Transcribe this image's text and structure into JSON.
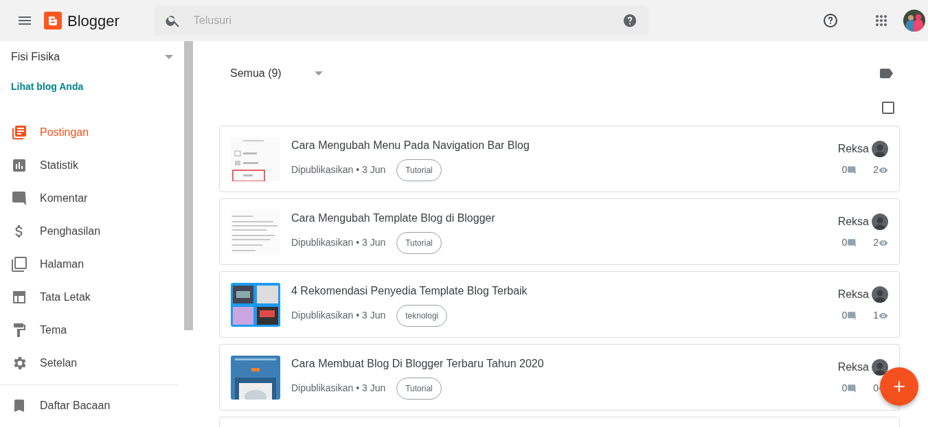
{
  "header": {
    "app_name": "Blogger",
    "search": {
      "placeholder": "Telusuri"
    }
  },
  "sidebar": {
    "blog_name": "Fisi Fisika",
    "view_blog_link": "Lihat blog Anda",
    "items": [
      {
        "label": "Postingan",
        "selected": true
      },
      {
        "label": "Statistik",
        "selected": false
      },
      {
        "label": "Komentar",
        "selected": false
      },
      {
        "label": "Penghasilan",
        "selected": false
      },
      {
        "label": "Halaman",
        "selected": false
      },
      {
        "label": "Tata Letak",
        "selected": false
      },
      {
        "label": "Tema",
        "selected": false
      },
      {
        "label": "Setelan",
        "selected": false
      }
    ],
    "bottom_items": [
      {
        "label": "Daftar Bacaan",
        "selected": false
      }
    ]
  },
  "filter": {
    "label": "Semua (9)"
  },
  "select_all": {
    "checked": false
  },
  "posts": [
    {
      "title": "Cara Mengubah Menu Pada Navigation Bar Blog",
      "meta": "Dipublikasikan • 3 Jun",
      "tag": "Tutorial",
      "author": "Reksa",
      "comments": "0",
      "views": "2"
    },
    {
      "title": "Cara Mengubah Template Blog di Blogger",
      "meta": "Dipublikasikan • 3 Jun",
      "tag": "Tutorial",
      "author": "Reksa",
      "comments": "0",
      "views": "2"
    },
    {
      "title": "4 Rekomendasi Penyedia Template Blog Terbaik",
      "meta": "Dipublikasikan • 3 Jun",
      "tag": "teknologi",
      "author": "Reksa",
      "comments": "0",
      "views": "1"
    },
    {
      "title": "Cara Membuat Blog Di Blogger Terbaru Tahun 2020",
      "meta": "Dipublikasikan • 3 Jun",
      "tag": "Tutorial",
      "author": "Reksa",
      "comments": "0",
      "views": "0"
    }
  ]
}
